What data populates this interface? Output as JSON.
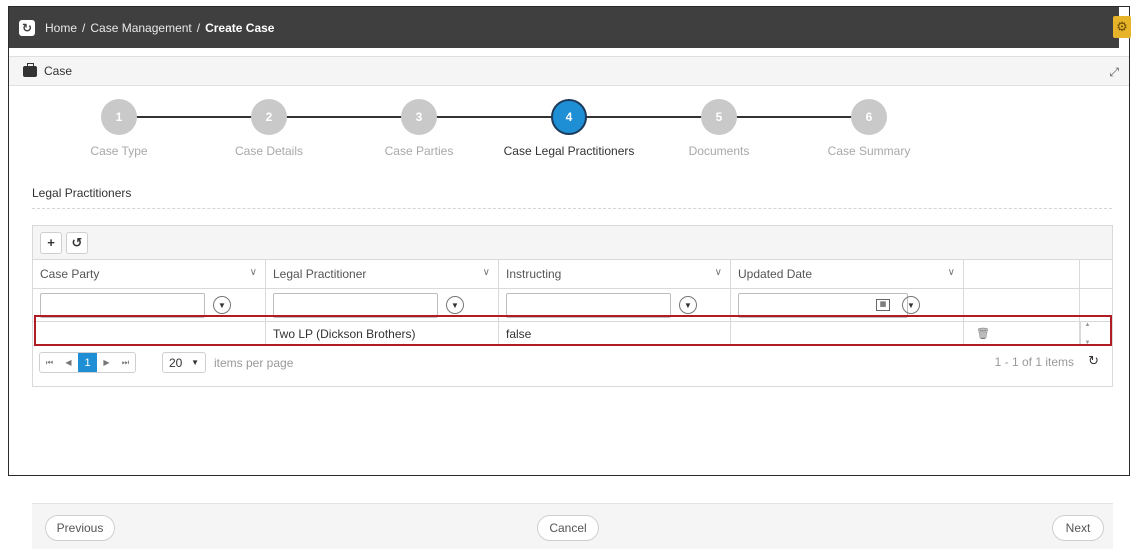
{
  "breadcrumb": {
    "items": [
      "Home",
      "Case Management",
      "Create Case"
    ]
  },
  "panel": {
    "title": "Case"
  },
  "stepper": {
    "steps": [
      {
        "number": "1",
        "label": "Case Type"
      },
      {
        "number": "2",
        "label": "Case Details"
      },
      {
        "number": "3",
        "label": "Case Parties"
      },
      {
        "number": "4",
        "label": "Case Legal Practitioners"
      },
      {
        "number": "5",
        "label": "Documents"
      },
      {
        "number": "6",
        "label": "Case Summary"
      }
    ],
    "active_step": 4
  },
  "section": {
    "title": "Legal Practitioners"
  },
  "grid": {
    "columns": [
      "Case Party",
      "Legal Practitioner",
      "Instructing",
      "Updated Date"
    ],
    "rows": [
      {
        "case_party": "",
        "legal_practitioner": "Two LP (Dickson Brothers)",
        "instructing": "false",
        "updated_date": ""
      }
    ],
    "pager": {
      "current_page": "1",
      "page_size": "20",
      "items_per_page_label": "items per page",
      "info": "1 - 1 of 1 items"
    }
  },
  "footer": {
    "previous_label": "Previous",
    "cancel_label": "Cancel",
    "next_label": "Next"
  },
  "colors": {
    "topbar": "#3f3f3f",
    "active_step": "#1e8fd5",
    "highlight": "#b11c24",
    "settings": "#e7b429"
  }
}
